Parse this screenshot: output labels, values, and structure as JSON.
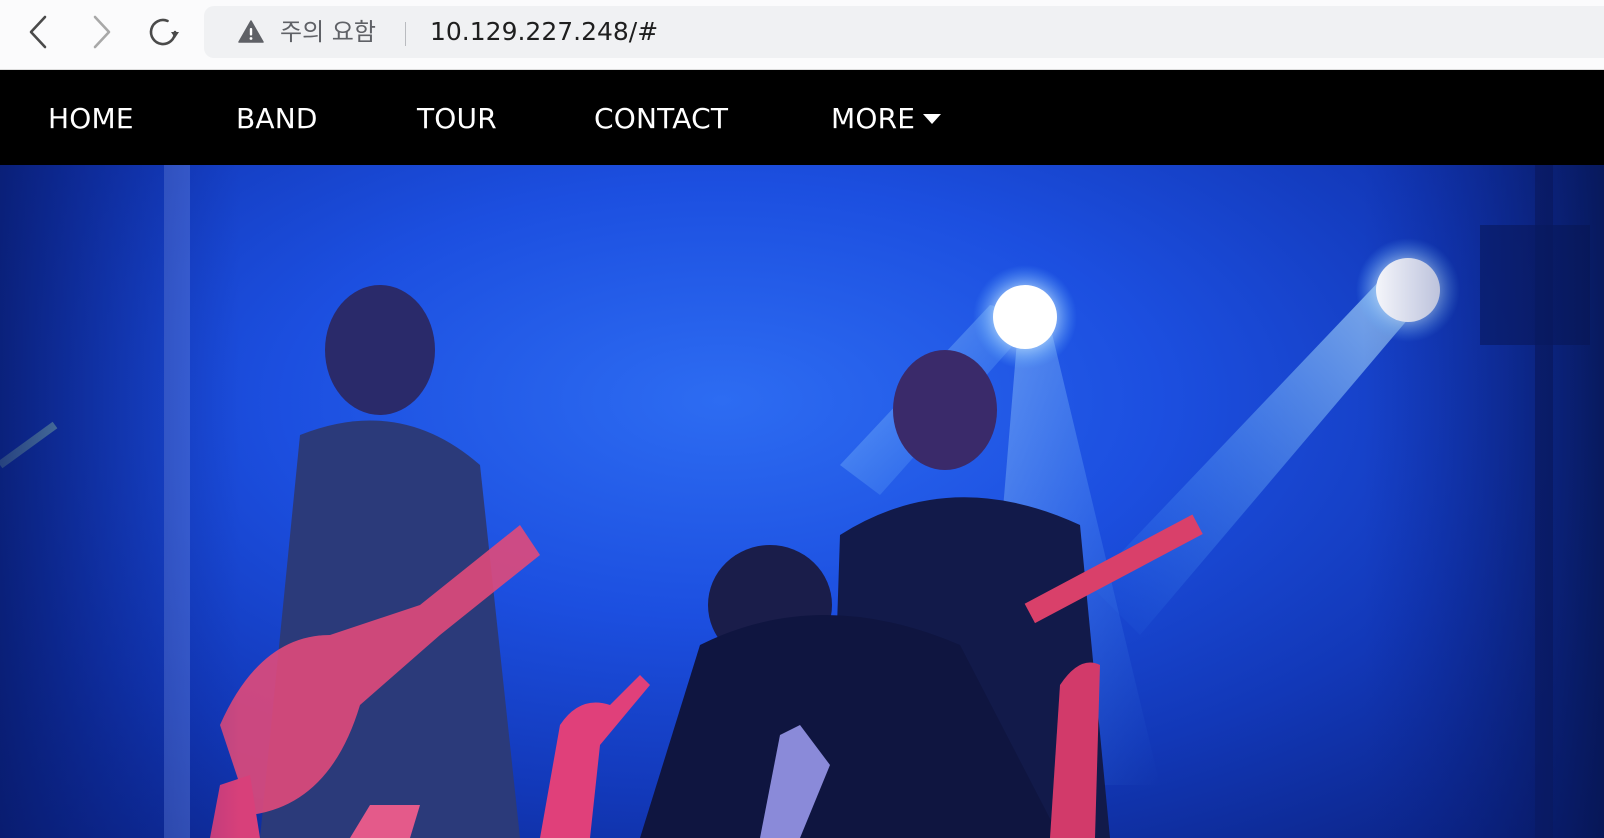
{
  "browser": {
    "security_label": "주의 요함",
    "url": "10.129.227.248/#",
    "icons": {
      "back": "chevron-left-icon",
      "forward": "chevron-right-icon",
      "reload": "reload-icon",
      "warning": "warning-triangle-icon"
    }
  },
  "nav": {
    "items": [
      {
        "label": "HOME"
      },
      {
        "label": "BAND"
      },
      {
        "label": "TOUR"
      },
      {
        "label": "CONTACT"
      },
      {
        "label": "MORE",
        "icon": "caret-down-icon"
      }
    ]
  },
  "colors": {
    "nav_background": "#000000",
    "nav_text": "#ffffff",
    "hero_blue": "#1c4fe0"
  }
}
